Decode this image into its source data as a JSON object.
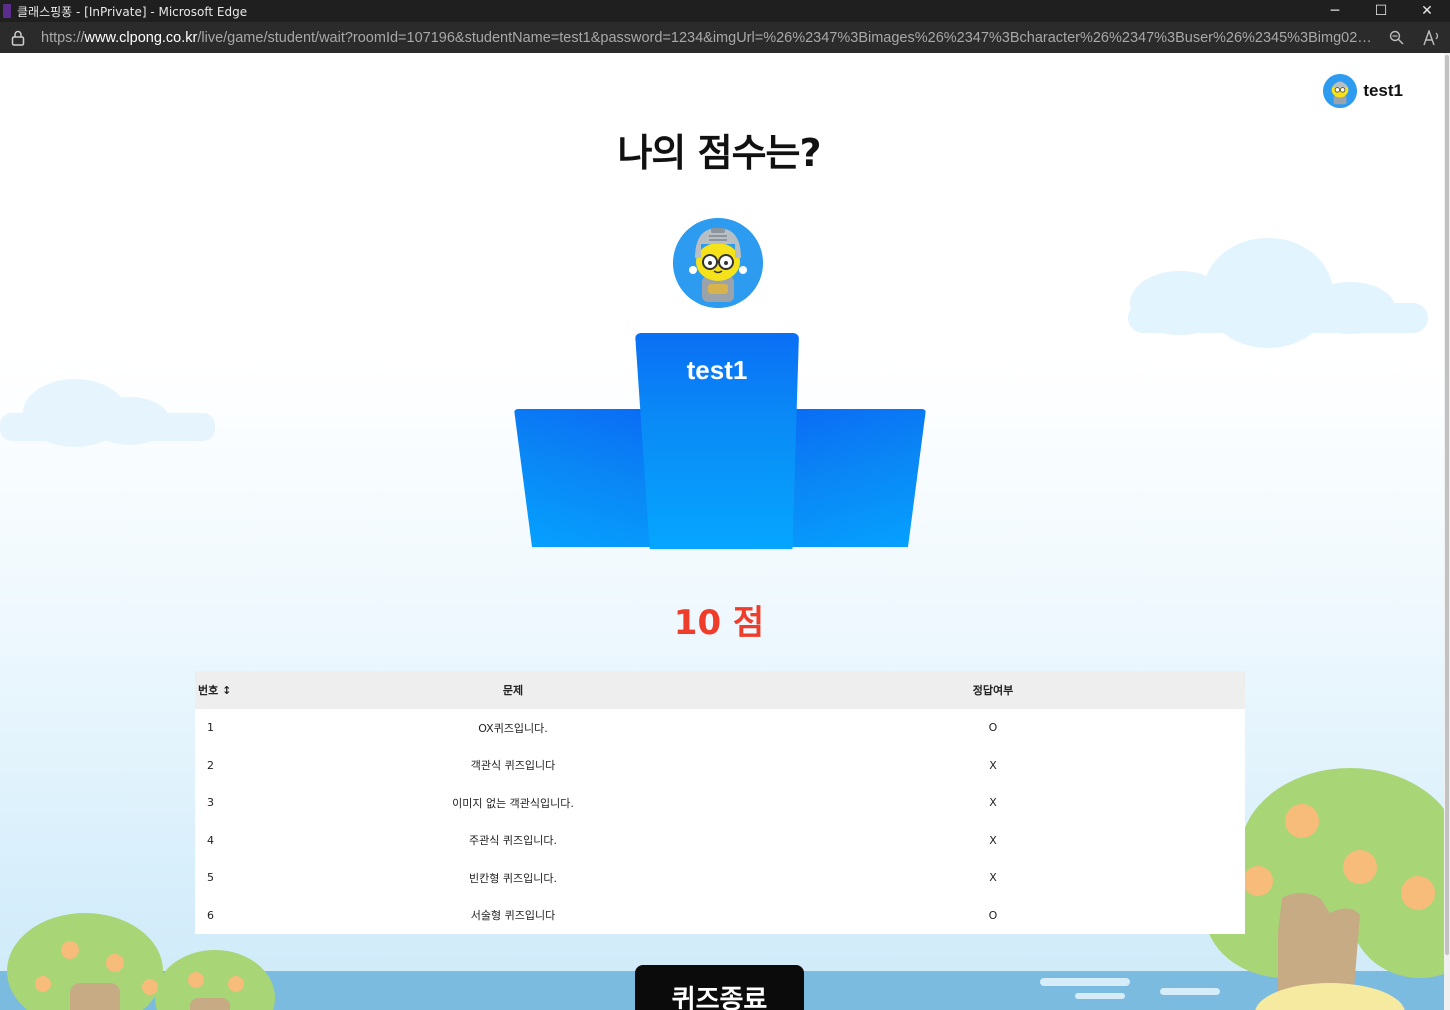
{
  "window": {
    "title": "클래스핑퐁 - [InPrivate] - Microsoft Edge",
    "minimize": "─",
    "maximize": "☐",
    "close": "✕"
  },
  "address_bar": {
    "url_prefix": "https://",
    "url_host": "www.clpong.co.kr",
    "url_path": "/live/game/student/wait?roomId=107196&studentName=test1&password=1234&imgUrl=%26%2347%3Bimages%26%2347%3Bcharacter%26%2347%3Buser%26%2345%3Bimg02%26%23...",
    "zoom_icon": "🔍",
    "read_aloud_icon": "A↑"
  },
  "user": {
    "name": "test1"
  },
  "page": {
    "title": "나의 점수는?",
    "podium_name": "test1",
    "score": "10 점",
    "end_button": "퀴즈종료"
  },
  "table": {
    "headers": [
      "번호 ↕",
      "문제",
      "정답여부"
    ],
    "rows": [
      {
        "num": "1",
        "question": "OX퀴즈입니다.",
        "answer": "O"
      },
      {
        "num": "2",
        "question": "객관식 퀴즈입니다",
        "answer": "X"
      },
      {
        "num": "3",
        "question": "이미지 없는 객관식입니다.",
        "answer": "X"
      },
      {
        "num": "4",
        "question": "주관식 퀴즈입니다.",
        "answer": "X"
      },
      {
        "num": "5",
        "question": "빈칸형 퀴즈입니다.",
        "answer": "X"
      },
      {
        "num": "6",
        "question": "서술형 퀴즈입니다",
        "answer": "O"
      }
    ]
  },
  "colors": {
    "score_red": "#ef3d2b",
    "podium_blue": "#0a86f5",
    "avatar_blue": "#2c9bf0"
  }
}
